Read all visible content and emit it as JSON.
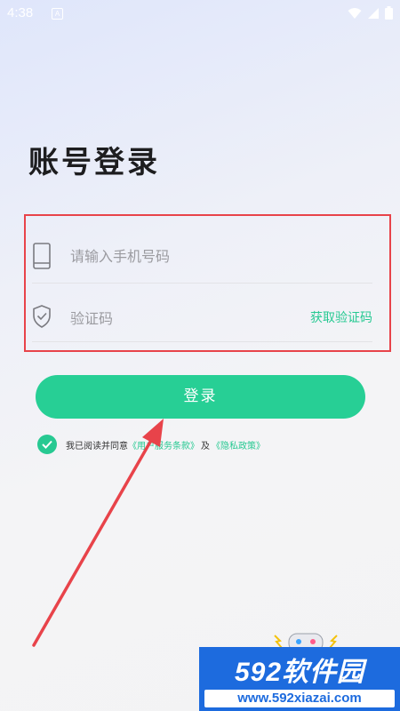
{
  "status": {
    "time": "4:38",
    "notif": "A"
  },
  "title": "账号登录",
  "phone": {
    "placeholder": "请输入手机号码"
  },
  "code": {
    "placeholder": "验证码",
    "action": "获取验证码"
  },
  "login_button": "登录",
  "agreement": {
    "prefix": "我已阅读并同意",
    "terms": "《用户服务条款》",
    "and": "及",
    "privacy": "《隐私政策》",
    "checked": true
  },
  "watermark": {
    "logo": "592软件园",
    "url": "www.592xiazai.com"
  },
  "colors": {
    "accent": "#27C992",
    "annotation": "#E8434A",
    "watermark": "#1D6BDE"
  }
}
